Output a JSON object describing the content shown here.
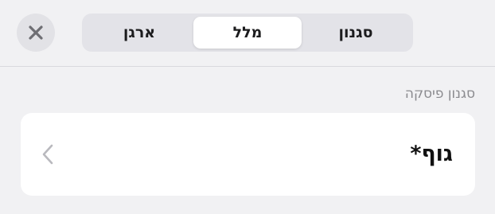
{
  "tabs": {
    "style_label": "סגנון",
    "text_label": "מלל",
    "arrange_label": "ארגן",
    "active": "מלל"
  },
  "close_icon": "close-icon",
  "paragraph_style": {
    "section_label": "סגנון פיסקה",
    "value": "גוף*",
    "chevron_icon": "chevron-left-icon"
  },
  "colors": {
    "background": "#f1f1f3",
    "card": "#ffffff",
    "segment_track": "#e3e3e8",
    "secondary_text": "#8a8a8e"
  }
}
